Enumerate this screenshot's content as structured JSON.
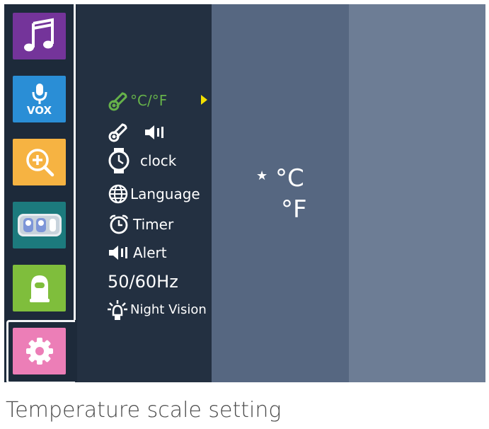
{
  "sidebar": {
    "tiles": [
      {
        "name": "music",
        "icon": "music-note-icon",
        "color": "#74349a"
      },
      {
        "name": "vox",
        "icon": "microphone-icon",
        "label": "VOX",
        "color": "#2a8ed6"
      },
      {
        "name": "zoom",
        "icon": "zoom-in-icon",
        "color": "#f6b342"
      },
      {
        "name": "cameras",
        "icon": "camera-group-icon",
        "color": "#1c7a7d"
      },
      {
        "name": "camera",
        "icon": "camera-icon",
        "color": "#7fbe3c"
      },
      {
        "name": "settings",
        "icon": "gear-icon",
        "color": "#ec7eb7",
        "selected": true
      }
    ]
  },
  "menu": {
    "items": [
      {
        "label": "°C/°F",
        "icon": "thermometer-icon",
        "active": true
      },
      {
        "label": "",
        "icon": "thermometer-speaker-icon"
      },
      {
        "label": "clock",
        "icon": "watch-icon"
      },
      {
        "label": "Language",
        "icon": "globe-icon"
      },
      {
        "label": "Timer",
        "icon": "alarm-clock-icon"
      },
      {
        "label": "Alert",
        "icon": "speaker-icon"
      },
      {
        "label": "50/60Hz"
      },
      {
        "label": "Night Vision",
        "icon": "night-vision-icon"
      }
    ],
    "accent": "#66b24a",
    "arrow_color": "#f3e000"
  },
  "options": {
    "items": [
      {
        "label": "°C",
        "selected": true
      },
      {
        "label": "°F",
        "selected": false
      }
    ],
    "selected_marker": "★"
  },
  "caption": "Temperature scale setting"
}
